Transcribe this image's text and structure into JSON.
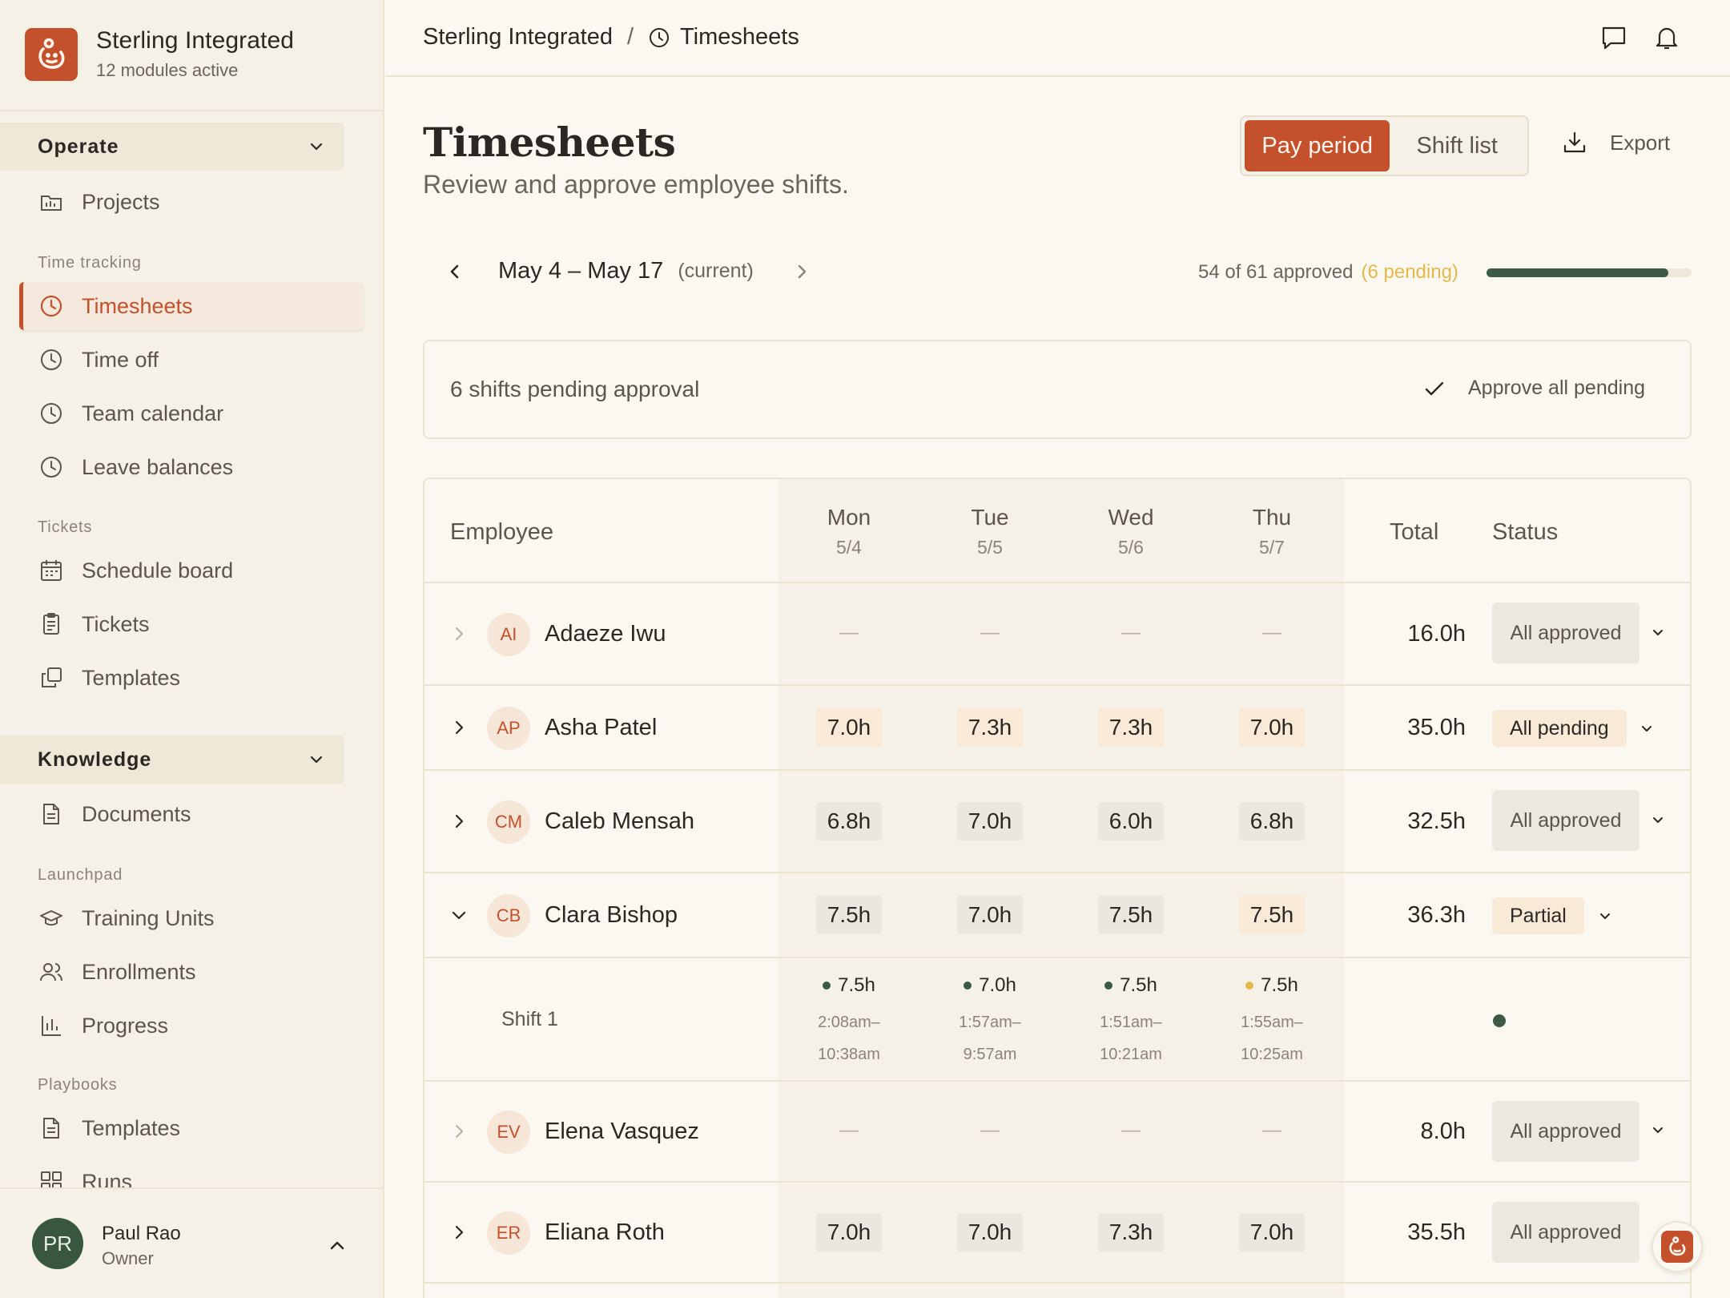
{
  "brand": {
    "name": "Sterling Integrated",
    "subtitle": "12 modules active",
    "color": "#c4512c"
  },
  "sidebar": {
    "operate_label": "Operate",
    "projects": "Projects",
    "time_tracking_label": "Time tracking",
    "timesheets": "Timesheets",
    "time_off": "Time off",
    "team_calendar": "Team calendar",
    "leave_balances": "Leave balances",
    "tickets_label": "Tickets",
    "schedule_board": "Schedule board",
    "tickets": "Tickets",
    "templates": "Templates",
    "knowledge_label": "Knowledge",
    "documents": "Documents",
    "launchpad_label": "Launchpad",
    "training_units": "Training Units",
    "enrollments": "Enrollments",
    "progress": "Progress",
    "playbooks_label": "Playbooks",
    "playbook_templates": "Templates",
    "runs": "Runs"
  },
  "user": {
    "initials": "PR",
    "name": "Paul Rao",
    "role": "Owner"
  },
  "breadcrumb": {
    "org": "Sterling Integrated",
    "separator": "/",
    "page": "Timesheets"
  },
  "header": {
    "title": "Timesheets",
    "subtitle": "Review and approve employee shifts."
  },
  "view_toggle": {
    "active": "Pay period",
    "inactive": "Shift list"
  },
  "export_label": "Export",
  "period": {
    "range": "May 4 – May 17",
    "tag": "(current)"
  },
  "approval": {
    "summary": "54 of 61 approved",
    "pending": "(6 pending)",
    "fraction": 0.885
  },
  "pending_banner": {
    "text": "6 shifts pending approval",
    "action": "Approve all pending"
  },
  "table": {
    "col_employee": "Employee",
    "days": [
      {
        "day": "Mon",
        "date": "5/4"
      },
      {
        "day": "Tue",
        "date": "5/5"
      },
      {
        "day": "Wed",
        "date": "5/6"
      },
      {
        "day": "Thu",
        "date": "5/7"
      }
    ],
    "col_total": "Total",
    "col_status": "Status",
    "rows": [
      {
        "initials": "AI",
        "name": "Adaeze Iwu",
        "cells": [
          "—",
          "—",
          "—",
          "—"
        ],
        "total": "16.0h",
        "status": "All approved"
      },
      {
        "initials": "AP",
        "name": "Asha Patel",
        "cells": [
          "7.0h",
          "7.3h",
          "7.3h",
          "7.0h"
        ],
        "total": "35.0h",
        "status": "All pending"
      },
      {
        "initials": "CM",
        "name": "Caleb Mensah",
        "cells": [
          "6.8h",
          "7.0h",
          "6.0h",
          "6.8h"
        ],
        "total": "32.5h",
        "status": "All approved"
      },
      {
        "initials": "CB",
        "name": "Clara Bishop",
        "cells": [
          "7.5h",
          "7.0h",
          "7.5h",
          "7.5h"
        ],
        "total": "36.3h",
        "status": "Partial"
      },
      {
        "initials": "EV",
        "name": "Elena Vasquez",
        "cells": [
          "—",
          "—",
          "—",
          "—"
        ],
        "total": "8.0h",
        "status": "All approved"
      },
      {
        "initials": "ER",
        "name": "Eliana Roth",
        "cells": [
          "7.0h",
          "7.0h",
          "7.3h",
          "7.0h"
        ],
        "total": "35.5h",
        "status": "All approved"
      }
    ],
    "shift": {
      "label": "Shift 1",
      "cells": [
        {
          "hours": "7.5h",
          "start": "2:08am–",
          "end": "10:38am",
          "state": "approved"
        },
        {
          "hours": "7.0h",
          "start": "1:57am–",
          "end": "9:57am",
          "state": "approved"
        },
        {
          "hours": "7.5h",
          "start": "1:51am–",
          "end": "10:21am",
          "state": "approved"
        },
        {
          "hours": "7.5h",
          "start": "1:55am–",
          "end": "10:25am",
          "state": "pending"
        }
      ]
    }
  },
  "colors": {
    "accent": "#c4512c",
    "approved": "#3c5a44",
    "pending": "#e7b74a"
  }
}
